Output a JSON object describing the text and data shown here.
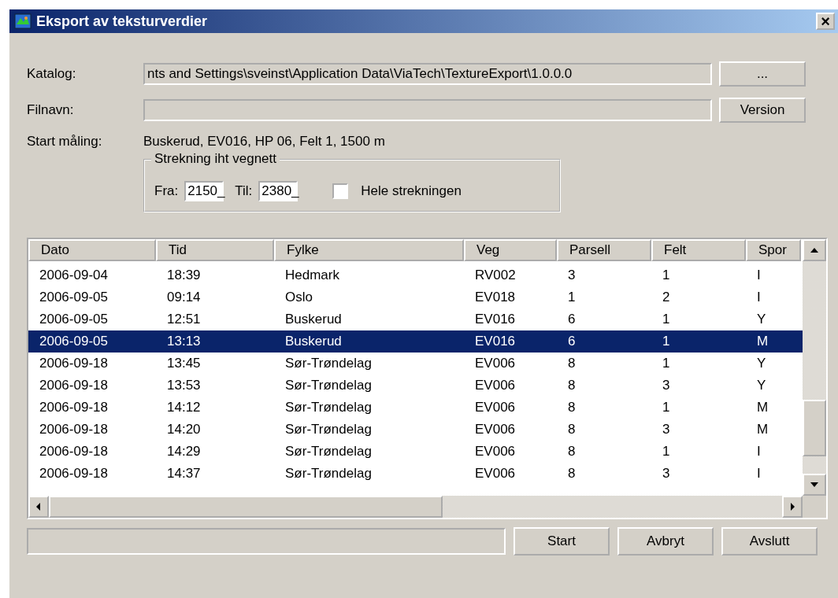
{
  "window": {
    "title": "Eksport av teksturverdier",
    "close": "×"
  },
  "fields": [
    {
      "label": "Katalog:",
      "value": "nts and Settings\\sveinst\\Application Data\\ViaTech\\TextureExport\\1.0.0.0",
      "button": "..."
    },
    {
      "label": "Filnavn:",
      "button": "Version"
    }
  ],
  "start": {
    "label": "Start måling:",
    "value": "Buskerud, EV016, HP 06, Felt 1, 1500 m"
  },
  "range": {
    "legend": "Strekning iht vegnett",
    "from_label": "Fra:",
    "from": "2150_",
    "to_label": "Til:",
    "to": "2380_",
    "checkbox": {
      "label": "Hele strekningen",
      "checked": false
    }
  },
  "table": {
    "columns": [
      "Dato",
      "Tid",
      "Fylke",
      "Veg",
      "Parsell",
      "Felt",
      "Spor"
    ],
    "rows": [
      {
        "cells": [
          "2006-09-04",
          "18:39",
          "Hedmark",
          "RV002",
          "3",
          "1",
          "I"
        ],
        "selected": false
      },
      {
        "cells": [
          "2006-09-05",
          "09:14",
          "Oslo",
          "EV018",
          "1",
          "2",
          "I"
        ],
        "selected": false
      },
      {
        "cells": [
          "2006-09-05",
          "12:51",
          "Buskerud",
          "EV016",
          "6",
          "1",
          "Y"
        ],
        "selected": false
      },
      {
        "cells": [
          "2006-09-05",
          "13:13",
          "Buskerud",
          "EV016",
          "6",
          "1",
          "M"
        ],
        "selected": true
      },
      {
        "cells": [
          "2006-09-18",
          "13:45",
          "Sør-Trøndelag",
          "EV006",
          "8",
          "1",
          "Y"
        ],
        "selected": false
      },
      {
        "cells": [
          "2006-09-18",
          "13:53",
          "Sør-Trøndelag",
          "EV006",
          "8",
          "3",
          "Y"
        ],
        "selected": false
      },
      {
        "cells": [
          "2006-09-18",
          "14:12",
          "Sør-Trøndelag",
          "EV006",
          "8",
          "1",
          "M"
        ],
        "selected": false
      },
      {
        "cells": [
          "2006-09-18",
          "14:20",
          "Sør-Trøndelag",
          "EV006",
          "8",
          "3",
          "M"
        ],
        "selected": false
      },
      {
        "cells": [
          "2006-09-18",
          "14:29",
          "Sør-Trøndelag",
          "EV006",
          "8",
          "1",
          "I"
        ],
        "selected": false
      },
      {
        "cells": [
          "2006-09-18",
          "14:37",
          "Sør-Trøndelag",
          "EV006",
          "8",
          "3",
          "I"
        ],
        "selected": false
      }
    ]
  },
  "buttons": [
    "Start",
    "Avbryt",
    "Avslutt"
  ]
}
